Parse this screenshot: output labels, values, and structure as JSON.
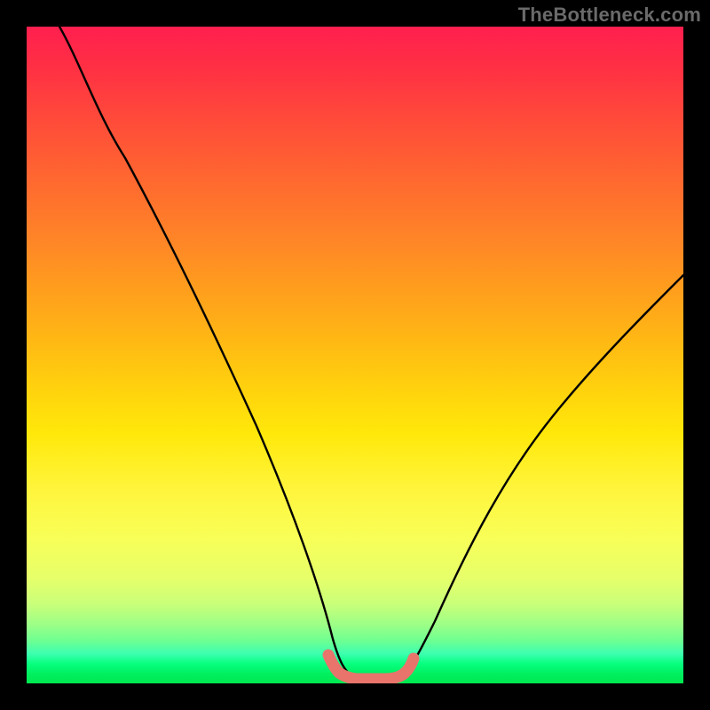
{
  "watermark": {
    "text": "TheBottleneck.com"
  },
  "chart_data": {
    "type": "line",
    "title": "",
    "xlabel": "",
    "ylabel": "",
    "xlim": [
      0,
      100
    ],
    "ylim": [
      0,
      100
    ],
    "grid": false,
    "legend": false,
    "background": "rainbow-gradient (red→orange→yellow→green, top→bottom)",
    "series": [
      {
        "name": "bottleneck-curve",
        "color": "#000000",
        "x": [
          5,
          10,
          15,
          20,
          25,
          30,
          35,
          40,
          45,
          48,
          50,
          53,
          56,
          58,
          60,
          65,
          70,
          75,
          80,
          85,
          90,
          95,
          100
        ],
        "values": [
          100,
          90,
          80,
          70,
          60,
          49,
          38,
          27,
          14,
          5,
          2,
          1,
          1,
          2,
          5,
          12,
          20,
          28,
          36,
          43,
          50,
          56,
          62
        ]
      },
      {
        "name": "optimal-range-marker",
        "color": "#e8746c",
        "x": [
          46,
          48,
          50,
          52,
          54,
          56,
          58
        ],
        "values": [
          3,
          1,
          0.6,
          0.4,
          0.5,
          0.8,
          2
        ]
      }
    ],
    "annotations": []
  }
}
